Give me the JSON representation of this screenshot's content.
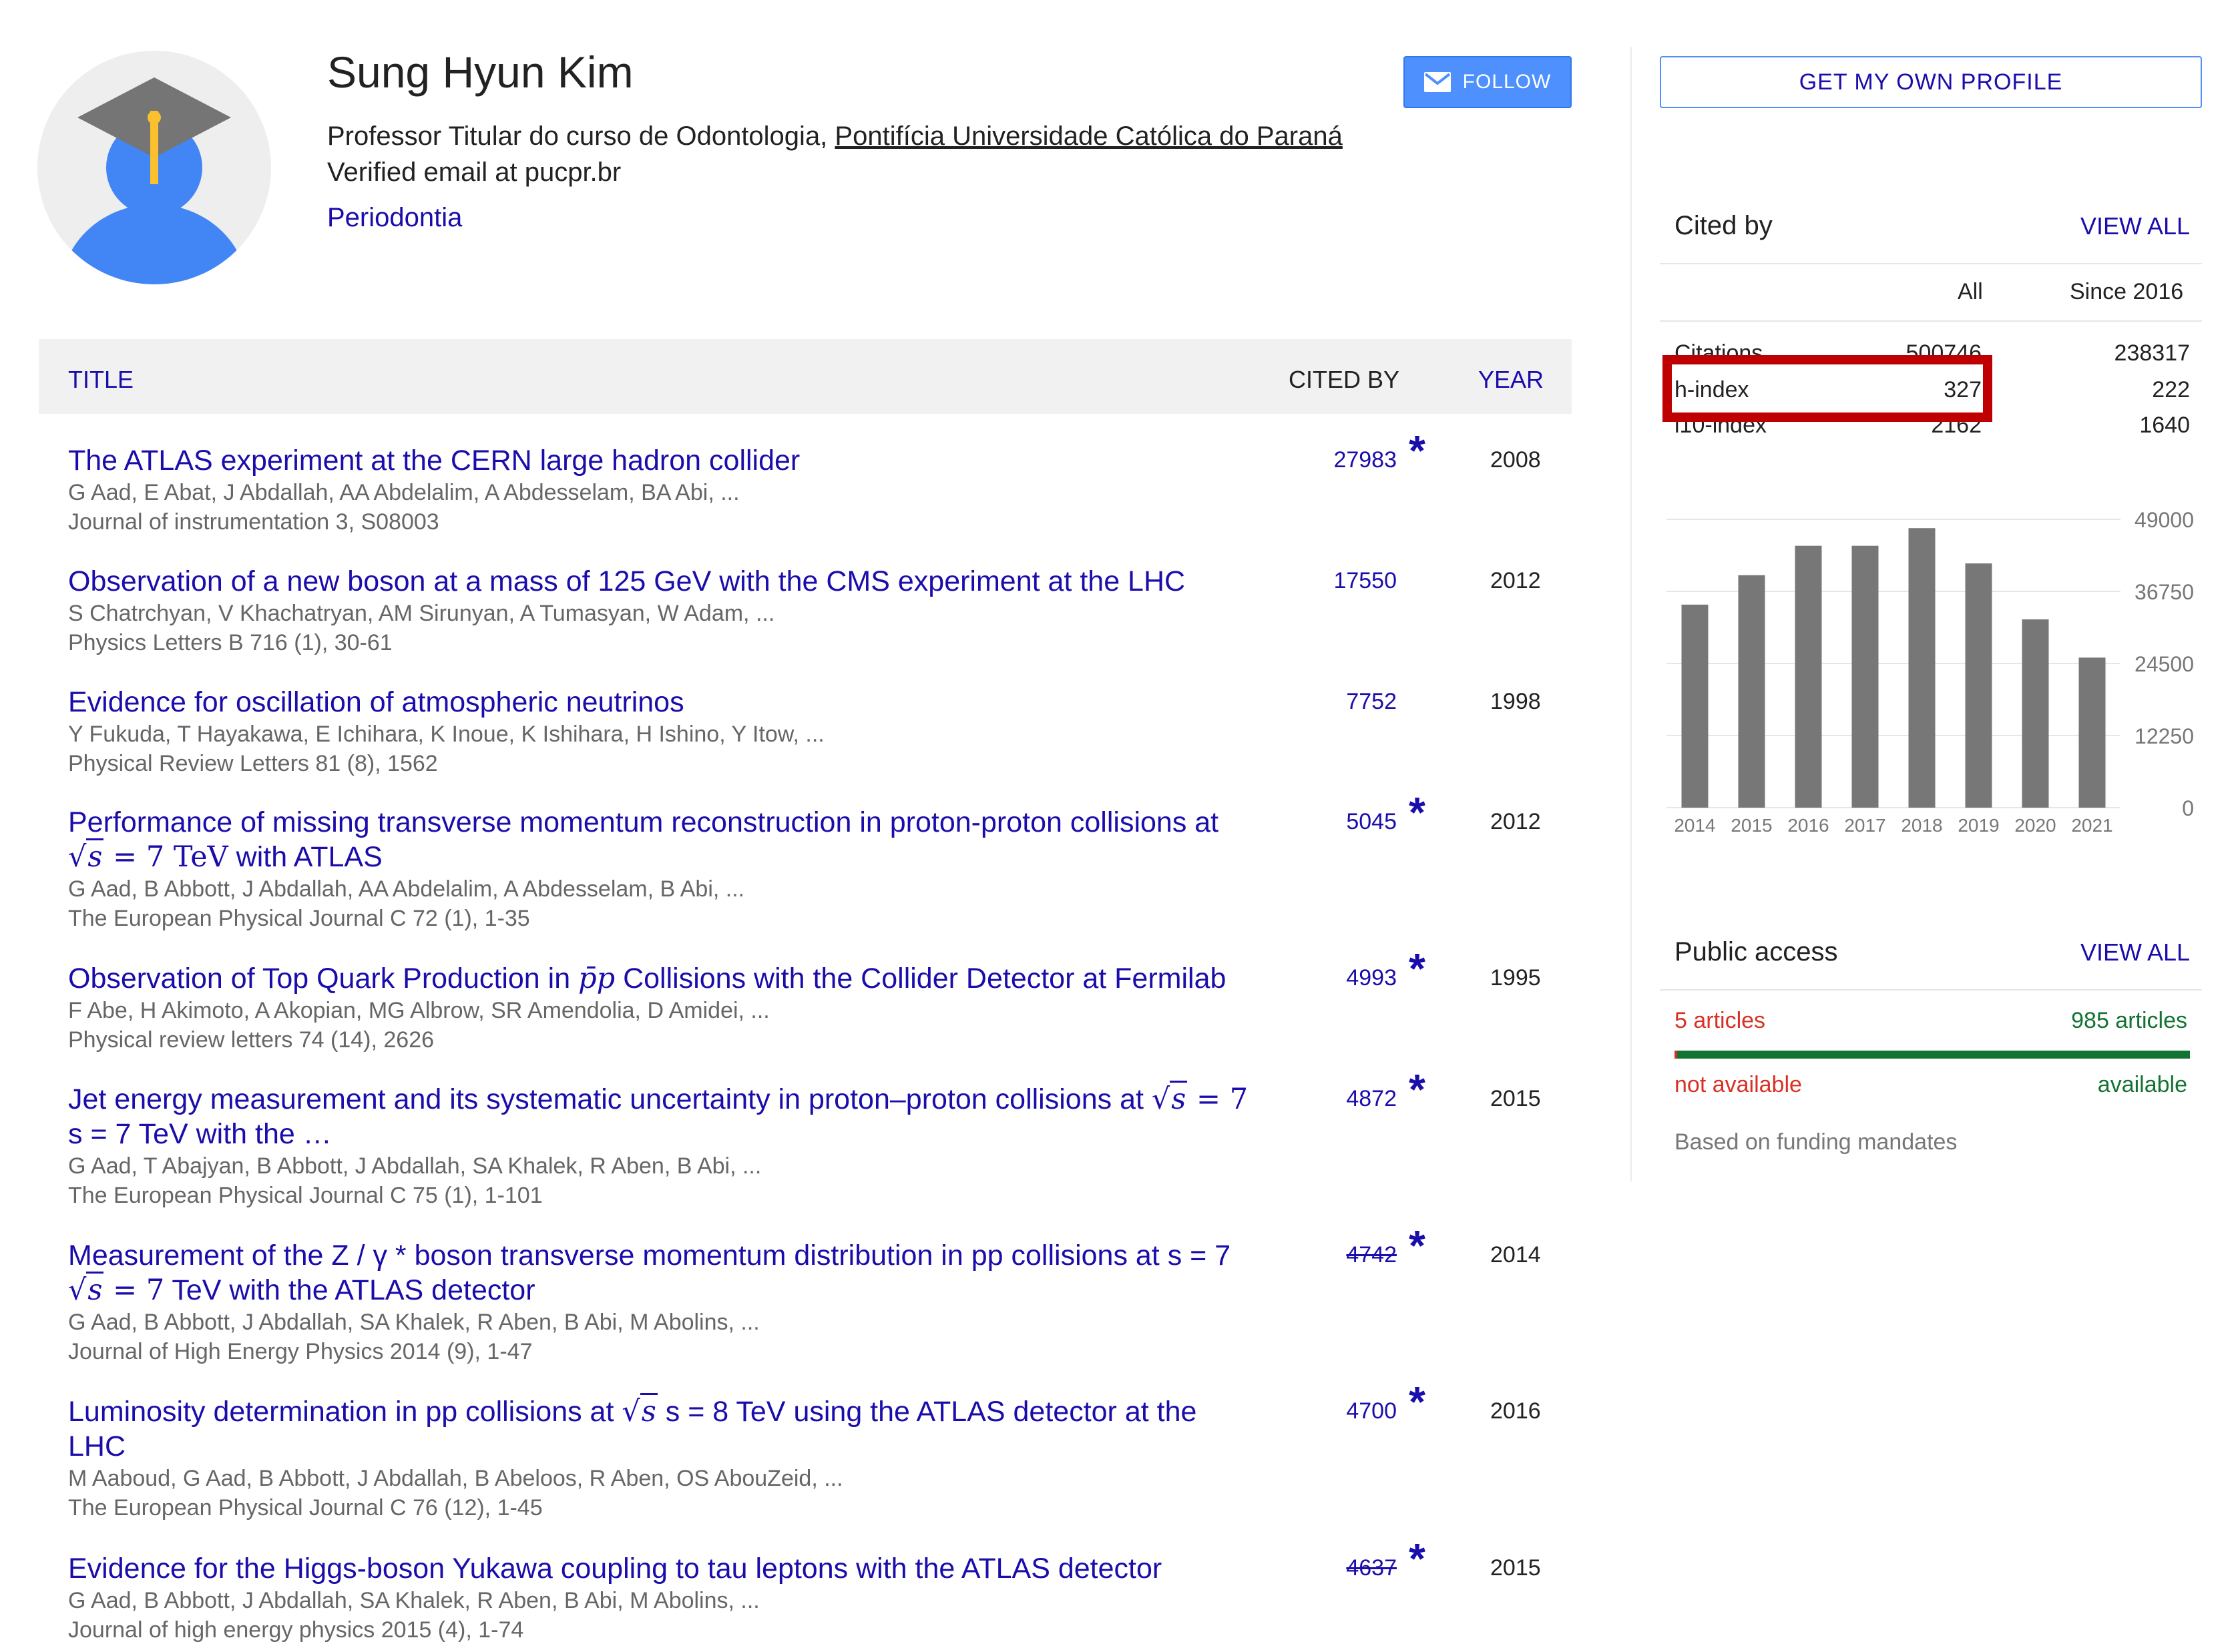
{
  "profile": {
    "name": "Sung Hyun Kim",
    "affiliation_prefix": "Professor Titular do curso de Odontologia, ",
    "affiliation_link": "Pontifícia Universidade Católica do Paraná",
    "email": "Verified email at pucpr.br",
    "interest": "Periodontia",
    "follow_label": "FOLLOW"
  },
  "table": {
    "col_title": "TITLE",
    "col_cited": "CITED BY",
    "col_year": "YEAR"
  },
  "articles": [
    {
      "title": "The ATLAS experiment at the CERN large hadron collider",
      "authors": "G Aad, E Abat, J Abdallah, AA Abdelalim, A Abdesselam, BA Abi, ...",
      "venue": "Journal of instrumentation 3, S08003",
      "cited": "27983",
      "star": "*",
      "year": "2008"
    },
    {
      "title": "Observation of a new boson at a mass of 125 GeV with the CMS experiment at the LHC",
      "authors": "S Chatrchyan, V Khachatryan, AM Sirunyan, A Tumasyan, W Adam, ...",
      "venue": "Physics Letters B 716 (1), 30-61",
      "cited": "17550",
      "year": "2012"
    },
    {
      "title": "Evidence for oscillation of atmospheric neutrinos",
      "authors": "Y Fukuda, T Hayakawa, E Ichihara, K Inoue, K Ishihara, H Ishino, Y Itow, ...",
      "venue": "Physical Review Letters 81 (8), 1562",
      "cited": "7752",
      "year": "1998"
    },
    {
      "title": "Performance of missing transverse momentum reconstruction in proton-proton collisions at",
      "title_math": "s",
      "title_math_tail": " = 7 TeV",
      "title_suffix": " with ATLAS",
      "authors": "G Aad, B Abbott, J Abdallah, AA Abdelalim, A Abdesselam, B Abi, ...",
      "venue": "The European Physical Journal C 72 (1), 1-35",
      "cited": "5045",
      "star": "*",
      "year": "2012"
    },
    {
      "title_prefix": "Observation of Top Quark Production in ",
      "title_math": "p̄p",
      "title_suffix": " Collisions with the Collider Detector at Fermilab",
      "authors": "F Abe, H Akimoto, A Akopian, MG Albrow, SR Amendolia, D Amidei, ...",
      "venue": "Physical review letters 74 (14), 2626",
      "cited": "4993",
      "star": "*",
      "year": "1995"
    },
    {
      "title": "Jet energy measurement and its systematic uncertainty in proton–proton collisions at",
      "title_math": "s",
      "title_math_tail": " = 7",
      "title_line2": "s = 7  TeV with the …",
      "authors": "G Aad, T Abajyan, B Abbott, J Abdallah, SA Khalek, R Aben, B Abi, ...",
      "venue": "The European Physical Journal C 75 (1), 1-101",
      "cited": "4872",
      "star": "*",
      "year": "2015"
    },
    {
      "title": "Measurement of the Z / γ * boson transverse momentum distribution in pp collisions at s = 7",
      "title_math": "s",
      "title_math_tail": " = 7",
      "title_suffix": " TeV with the ATLAS detector",
      "authors": "G Aad, B Abbott, J Abdallah, SA Khalek, R Aben, B Abi, M Abolins, ...",
      "venue": "Journal of High Energy Physics 2014 (9), 1-47",
      "cited": "4742",
      "cited_strike": true,
      "star": "*",
      "year": "2014"
    },
    {
      "title_prefix": "Luminosity determination in pp collisions at ",
      "title_math": "s",
      "title_suffix": " s = 8 TeV using the ATLAS detector at the",
      "title_line2": "LHC",
      "authors": "M Aaboud, G Aad, B Abbott, J Abdallah, B Abeloos, R Aben, OS AbouZeid, ...",
      "venue": "The European Physical Journal C 76 (12), 1-45",
      "cited": "4700",
      "star": "*",
      "year": "2016"
    },
    {
      "title": "Evidence for the Higgs-boson Yukawa coupling to tau leptons with the ATLAS detector",
      "authors": "G Aad, B Abbott, J Abdallah, SA Khalek, R Aben, B Abi, M Abolins, ...",
      "venue": "Journal of high energy physics 2015 (4), 1-74",
      "cited": "4637",
      "cited_strike": true,
      "star": "*",
      "year": "2015"
    }
  ],
  "sidebar": {
    "get_profile_label": "GET MY OWN PROFILE",
    "cited_by_title": "Cited by",
    "view_all": "VIEW ALL",
    "col_all": "All",
    "col_since": "Since 2016",
    "stats": [
      {
        "label": "Citations",
        "all": "500746",
        "since": "238317"
      },
      {
        "label": "h-index",
        "all": "327",
        "since": "222"
      },
      {
        "label": "i10-index",
        "all": "2162",
        "since": "1640"
      }
    ],
    "highlight_color": "#c00000",
    "public_access_title": "Public access",
    "pa_view_all": "VIEW ALL",
    "pa_unavailable_count": "5 articles",
    "pa_available_count": "985 articles",
    "pa_unavailable_label": "not available",
    "pa_available_label": "available",
    "pa_note": "Based on funding mandates",
    "pa_available_fraction": 0.995,
    "colors": {
      "unavailable": "#d93025",
      "available": "#137333"
    }
  },
  "chart_data": {
    "type": "bar",
    "categories": [
      "2014",
      "2015",
      "2016",
      "2017",
      "2018",
      "2019",
      "2020",
      "2021"
    ],
    "values": [
      34500,
      39500,
      44500,
      44500,
      47500,
      41500,
      32000,
      25500
    ],
    "yticks": [
      "49000",
      "36750",
      "24500",
      "12250",
      "0"
    ],
    "ylim": [
      0,
      49000
    ],
    "bar_color": "#777777",
    "grid": true,
    "title": "",
    "xlabel": "",
    "ylabel": ""
  }
}
